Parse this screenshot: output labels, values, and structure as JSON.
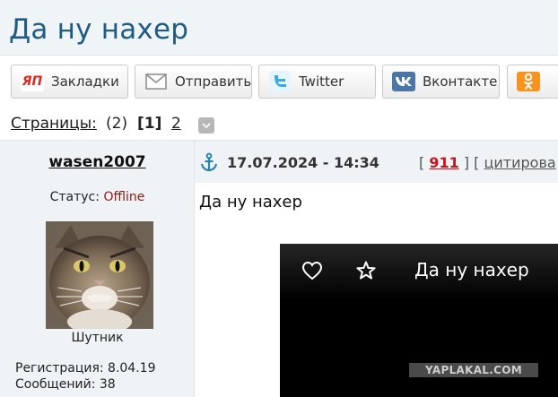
{
  "header": {
    "title": "Да ну нахер"
  },
  "share": {
    "buttons": [
      {
        "label": "Закладки",
        "icon": "yandex-bookmarks-icon"
      },
      {
        "label": "Отправить",
        "icon": "envelope-icon"
      },
      {
        "label": "Twitter",
        "icon": "twitter-bird-icon"
      },
      {
        "label": "Вконтакте",
        "icon": "vk-logo-icon"
      },
      {
        "label": "",
        "icon": "odnoklassniki-logo-icon"
      }
    ]
  },
  "pagination": {
    "label": "Страницы:",
    "count": "(2)",
    "current": "[1]",
    "next": "2"
  },
  "post": {
    "author": "wasen2007",
    "date": "17.07.2024 - 14:34",
    "rating_open": "[ ",
    "rating": "911",
    "rating_close": " ] [ ",
    "quote": "цитирова",
    "status_label": "Статус: ",
    "status_value": "Offline",
    "rank": "Шутник",
    "registration": "Регистрация: 8.04.19",
    "messages": "Сообщений: 38",
    "text": "Да ну нахер"
  },
  "video": {
    "title": "Да ну нахер",
    "watermark": "YAPLAKAL.COM"
  },
  "colors": {
    "title": "#1f5b82",
    "rating": "#c8141c",
    "offline": "#8b1a1a",
    "vk": "#4a76a8",
    "ok": "#f7931e"
  }
}
